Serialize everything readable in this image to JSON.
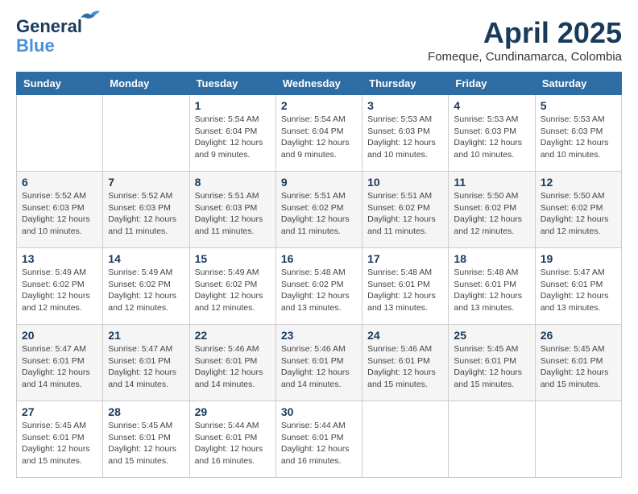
{
  "header": {
    "logo_line1": "General",
    "logo_line2": "Blue",
    "month_year": "April 2025",
    "location": "Fomeque, Cundinamarca, Colombia"
  },
  "weekdays": [
    "Sunday",
    "Monday",
    "Tuesday",
    "Wednesday",
    "Thursday",
    "Friday",
    "Saturday"
  ],
  "weeks": [
    [
      {
        "day": "",
        "info": ""
      },
      {
        "day": "",
        "info": ""
      },
      {
        "day": "1",
        "info": "Sunrise: 5:54 AM\nSunset: 6:04 PM\nDaylight: 12 hours\nand 9 minutes."
      },
      {
        "day": "2",
        "info": "Sunrise: 5:54 AM\nSunset: 6:04 PM\nDaylight: 12 hours\nand 9 minutes."
      },
      {
        "day": "3",
        "info": "Sunrise: 5:53 AM\nSunset: 6:03 PM\nDaylight: 12 hours\nand 10 minutes."
      },
      {
        "day": "4",
        "info": "Sunrise: 5:53 AM\nSunset: 6:03 PM\nDaylight: 12 hours\nand 10 minutes."
      },
      {
        "day": "5",
        "info": "Sunrise: 5:53 AM\nSunset: 6:03 PM\nDaylight: 12 hours\nand 10 minutes."
      }
    ],
    [
      {
        "day": "6",
        "info": "Sunrise: 5:52 AM\nSunset: 6:03 PM\nDaylight: 12 hours\nand 10 minutes."
      },
      {
        "day": "7",
        "info": "Sunrise: 5:52 AM\nSunset: 6:03 PM\nDaylight: 12 hours\nand 11 minutes."
      },
      {
        "day": "8",
        "info": "Sunrise: 5:51 AM\nSunset: 6:03 PM\nDaylight: 12 hours\nand 11 minutes."
      },
      {
        "day": "9",
        "info": "Sunrise: 5:51 AM\nSunset: 6:02 PM\nDaylight: 12 hours\nand 11 minutes."
      },
      {
        "day": "10",
        "info": "Sunrise: 5:51 AM\nSunset: 6:02 PM\nDaylight: 12 hours\nand 11 minutes."
      },
      {
        "day": "11",
        "info": "Sunrise: 5:50 AM\nSunset: 6:02 PM\nDaylight: 12 hours\nand 12 minutes."
      },
      {
        "day": "12",
        "info": "Sunrise: 5:50 AM\nSunset: 6:02 PM\nDaylight: 12 hours\nand 12 minutes."
      }
    ],
    [
      {
        "day": "13",
        "info": "Sunrise: 5:49 AM\nSunset: 6:02 PM\nDaylight: 12 hours\nand 12 minutes."
      },
      {
        "day": "14",
        "info": "Sunrise: 5:49 AM\nSunset: 6:02 PM\nDaylight: 12 hours\nand 12 minutes."
      },
      {
        "day": "15",
        "info": "Sunrise: 5:49 AM\nSunset: 6:02 PM\nDaylight: 12 hours\nand 12 minutes."
      },
      {
        "day": "16",
        "info": "Sunrise: 5:48 AM\nSunset: 6:02 PM\nDaylight: 12 hours\nand 13 minutes."
      },
      {
        "day": "17",
        "info": "Sunrise: 5:48 AM\nSunset: 6:01 PM\nDaylight: 12 hours\nand 13 minutes."
      },
      {
        "day": "18",
        "info": "Sunrise: 5:48 AM\nSunset: 6:01 PM\nDaylight: 12 hours\nand 13 minutes."
      },
      {
        "day": "19",
        "info": "Sunrise: 5:47 AM\nSunset: 6:01 PM\nDaylight: 12 hours\nand 13 minutes."
      }
    ],
    [
      {
        "day": "20",
        "info": "Sunrise: 5:47 AM\nSunset: 6:01 PM\nDaylight: 12 hours\nand 14 minutes."
      },
      {
        "day": "21",
        "info": "Sunrise: 5:47 AM\nSunset: 6:01 PM\nDaylight: 12 hours\nand 14 minutes."
      },
      {
        "day": "22",
        "info": "Sunrise: 5:46 AM\nSunset: 6:01 PM\nDaylight: 12 hours\nand 14 minutes."
      },
      {
        "day": "23",
        "info": "Sunrise: 5:46 AM\nSunset: 6:01 PM\nDaylight: 12 hours\nand 14 minutes."
      },
      {
        "day": "24",
        "info": "Sunrise: 5:46 AM\nSunset: 6:01 PM\nDaylight: 12 hours\nand 15 minutes."
      },
      {
        "day": "25",
        "info": "Sunrise: 5:45 AM\nSunset: 6:01 PM\nDaylight: 12 hours\nand 15 minutes."
      },
      {
        "day": "26",
        "info": "Sunrise: 5:45 AM\nSunset: 6:01 PM\nDaylight: 12 hours\nand 15 minutes."
      }
    ],
    [
      {
        "day": "27",
        "info": "Sunrise: 5:45 AM\nSunset: 6:01 PM\nDaylight: 12 hours\nand 15 minutes."
      },
      {
        "day": "28",
        "info": "Sunrise: 5:45 AM\nSunset: 6:01 PM\nDaylight: 12 hours\nand 15 minutes."
      },
      {
        "day": "29",
        "info": "Sunrise: 5:44 AM\nSunset: 6:01 PM\nDaylight: 12 hours\nand 16 minutes."
      },
      {
        "day": "30",
        "info": "Sunrise: 5:44 AM\nSunset: 6:01 PM\nDaylight: 12 hours\nand 16 minutes."
      },
      {
        "day": "",
        "info": ""
      },
      {
        "day": "",
        "info": ""
      },
      {
        "day": "",
        "info": ""
      }
    ]
  ]
}
